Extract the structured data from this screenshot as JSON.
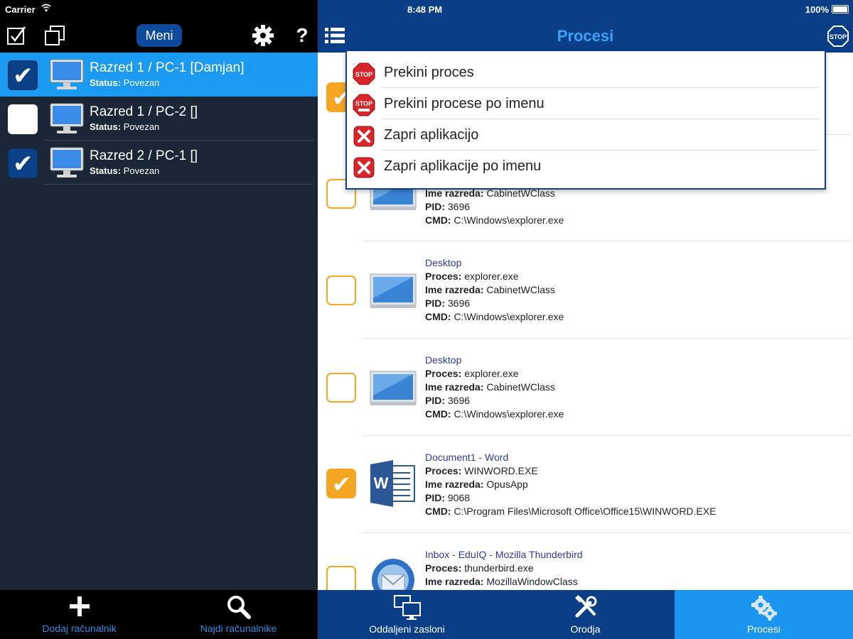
{
  "status_bar": {
    "carrier": "Carrier",
    "time": "8:48 PM",
    "battery": "100%"
  },
  "left_toolbar": {
    "menu_label": "Meni",
    "help_label": "?"
  },
  "computers": [
    {
      "name": "Razred 1 / PC-1 [Damjan]",
      "status_label": "Status:",
      "status": "Povezan",
      "checked": true,
      "selected": true
    },
    {
      "name": "Razred 1 / PC-2 []",
      "status_label": "Status:",
      "status": "Povezan",
      "checked": false,
      "selected": false
    },
    {
      "name": "Razred 2 / PC-1 []",
      "status_label": "Status:",
      "status": "Povezan",
      "checked": true,
      "selected": false
    }
  ],
  "left_bottom": {
    "add_label": "Dodaj računalnik",
    "find_label": "Najdi računalnike"
  },
  "header": {
    "title": "Procesi"
  },
  "popup_menu": [
    {
      "label": "Prekini proces",
      "icon": "stop-icon"
    },
    {
      "label": "Prekini procese po imenu",
      "icon": "stop-name-icon"
    },
    {
      "label": "Zapri aplikacijo",
      "icon": "close-x-icon"
    },
    {
      "label": "Zapri aplikacije po imenu",
      "icon": "close-x-icon"
    }
  ],
  "process_labels": {
    "proces": "Proces:",
    "ime_razreda": "Ime razreda:",
    "pid": "PID:",
    "cmd": "CMD:"
  },
  "processes": [
    {
      "title": "",
      "proces": "",
      "ime_razreda": "CabinetWClass",
      "pid": "3696",
      "cmd": "C:\\Windows\\explorer.exe",
      "checked": false,
      "icon": "desktop-icon"
    },
    {
      "title": "Desktop",
      "proces": "explorer.exe",
      "ime_razreda": "CabinetWClass",
      "pid": "3696",
      "cmd": "C:\\Windows\\explorer.exe",
      "checked": false,
      "icon": "desktop-icon"
    },
    {
      "title": "Desktop",
      "proces": "explorer.exe",
      "ime_razreda": "CabinetWClass",
      "pid": "3696",
      "cmd": "C:\\Windows\\explorer.exe",
      "checked": false,
      "icon": "desktop-icon"
    },
    {
      "title": "Document1 - Word",
      "proces": "WINWORD.EXE",
      "ime_razreda": "OpusApp",
      "pid": "9068",
      "cmd": "C:\\Program Files\\Microsoft Office\\Office15\\WINWORD.EXE",
      "checked": true,
      "icon": "word-icon"
    },
    {
      "title": "Inbox - EduIQ - Mozilla Thunderbird",
      "proces": "thunderbird.exe",
      "ime_razreda": "MozillaWindowClass",
      "pid": "",
      "cmd": "",
      "checked": false,
      "icon": "thunderbird-icon"
    }
  ],
  "tabs": [
    {
      "label": "Oddaljeni zasloni",
      "active": false
    },
    {
      "label": "Orodja",
      "active": false
    },
    {
      "label": "Procesi",
      "active": true
    }
  ],
  "colors": {
    "header_blue": "#0a3f87",
    "selected_blue": "#1a9af0",
    "checkbox_orange": "#f5a623",
    "dark_panel": "#1b2636"
  }
}
